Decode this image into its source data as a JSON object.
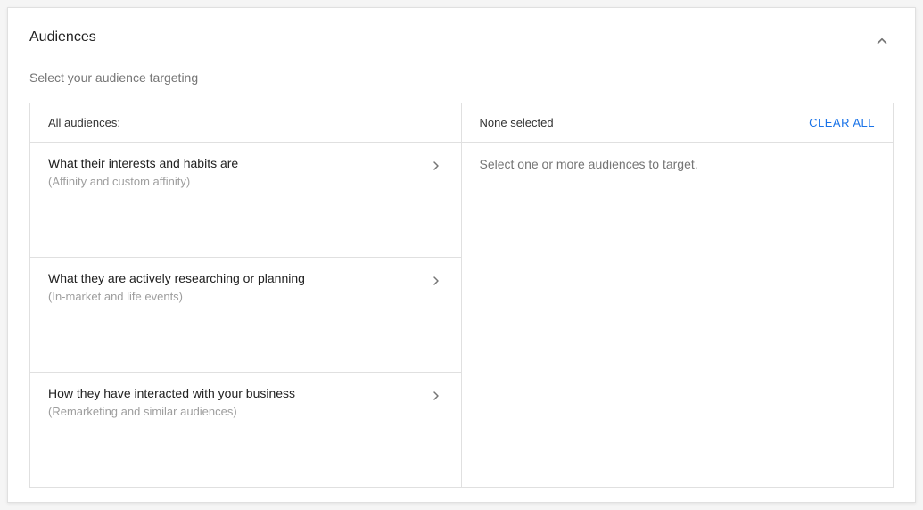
{
  "card": {
    "title": "Audiences",
    "subtitle": "Select your audience targeting"
  },
  "leftPanel": {
    "header": "All audiences:",
    "categories": [
      {
        "title": "What their interests and habits are",
        "subtitle": "(Affinity and custom affinity)"
      },
      {
        "title": "What they are actively researching or planning",
        "subtitle": "(In-market and life events)"
      },
      {
        "title": "How they have interacted with your business",
        "subtitle": "(Remarketing and similar audiences)"
      }
    ]
  },
  "rightPanel": {
    "header": "None selected",
    "clearAll": "CLEAR ALL",
    "emptyText": "Select one or more audiences to target."
  }
}
